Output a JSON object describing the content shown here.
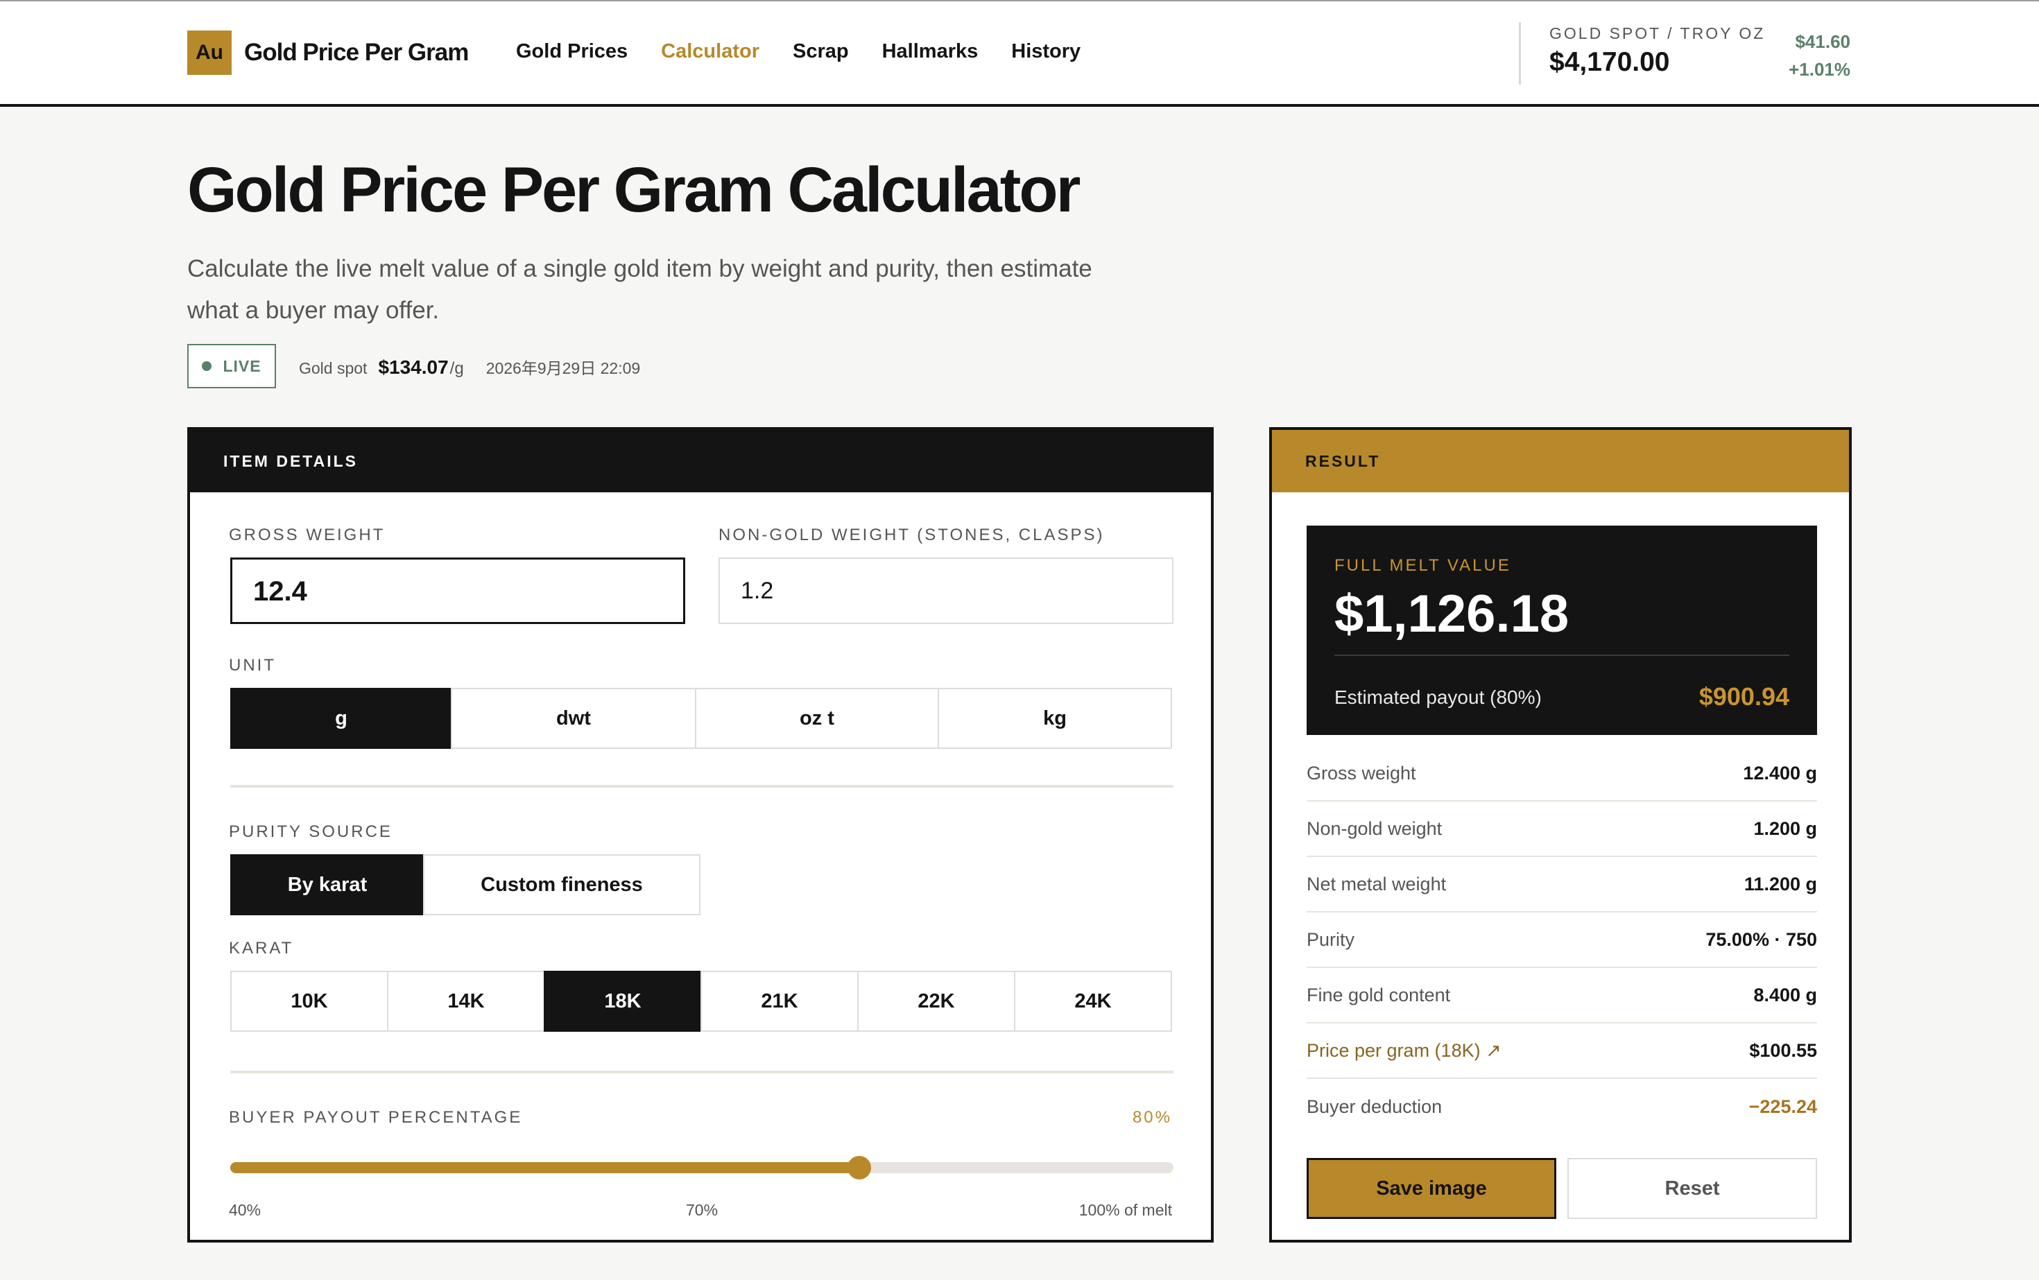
{
  "brand": {
    "mark": "Au",
    "name": "Gold Price Per Gram"
  },
  "nav": {
    "items": [
      {
        "label": "Gold Prices",
        "active": false
      },
      {
        "label": "Calculator",
        "active": true
      },
      {
        "label": "Scrap",
        "active": false
      },
      {
        "label": "Hallmarks",
        "active": false
      },
      {
        "label": "History",
        "active": false
      }
    ]
  },
  "spot": {
    "label": "GOLD SPOT / TROY OZ",
    "price": "$4,170.00",
    "change_abs": "$41.60",
    "change_pct": "+1.01%"
  },
  "header": {
    "title": "Gold Price Per Gram Calculator",
    "description": "Calculate the live melt value of a single gold item by weight and purity, then estimate what a buyer may offer.",
    "live_label": "LIVE",
    "spot_label": "Gold spot",
    "spot_value": "$134.07",
    "spot_unit": "/g",
    "timestamp": "2026年9月29日 22:09"
  },
  "item_details": {
    "heading": "ITEM DETAILS",
    "gross_weight_label": "GROSS WEIGHT",
    "gross_weight_value": "12.4",
    "non_gold_label": "NON-GOLD WEIGHT (STONES, CLASPS)",
    "non_gold_value": "1.2",
    "unit_label": "UNIT",
    "units": [
      "g",
      "dwt",
      "oz t",
      "kg"
    ],
    "unit_selected": "g",
    "purity_source_label": "PURITY SOURCE",
    "purity_sources": [
      "By karat",
      "Custom fineness"
    ],
    "purity_source_selected": "By karat",
    "karat_label": "KARAT",
    "karats": [
      "10K",
      "14K",
      "18K",
      "21K",
      "22K",
      "24K"
    ],
    "karat_selected": "18K",
    "payout_label": "BUYER PAYOUT PERCENTAGE",
    "payout_value": "80%",
    "payout_fraction": 0.6667,
    "slider_ticks": [
      "40%",
      "70%",
      "100% of melt"
    ]
  },
  "result": {
    "heading": "RESULT",
    "melt_label": "FULL MELT VALUE",
    "melt_value": "$1,126.18",
    "payout_label": "Estimated payout (80%)",
    "payout_value": "$900.94",
    "rows": [
      {
        "label": "Gross weight",
        "value": "12.400 g"
      },
      {
        "label": "Non-gold weight",
        "value": "1.200 g"
      },
      {
        "label": "Net metal weight",
        "value": "11.200 g"
      },
      {
        "label": "Purity",
        "value": "75.00% · 750"
      },
      {
        "label": "Fine gold content",
        "value": "8.400 g"
      },
      {
        "label": "Price per gram (18K) ↗",
        "value": "$100.55"
      },
      {
        "label": "Buyer deduction",
        "value": "−225.24"
      }
    ],
    "save_label": "Save image",
    "reset_label": "Reset"
  },
  "colors": {
    "accent_gold": "#b8892a",
    "ink": "#141414",
    "positive_green": "#5a806a",
    "background": "#f6f6f4"
  }
}
